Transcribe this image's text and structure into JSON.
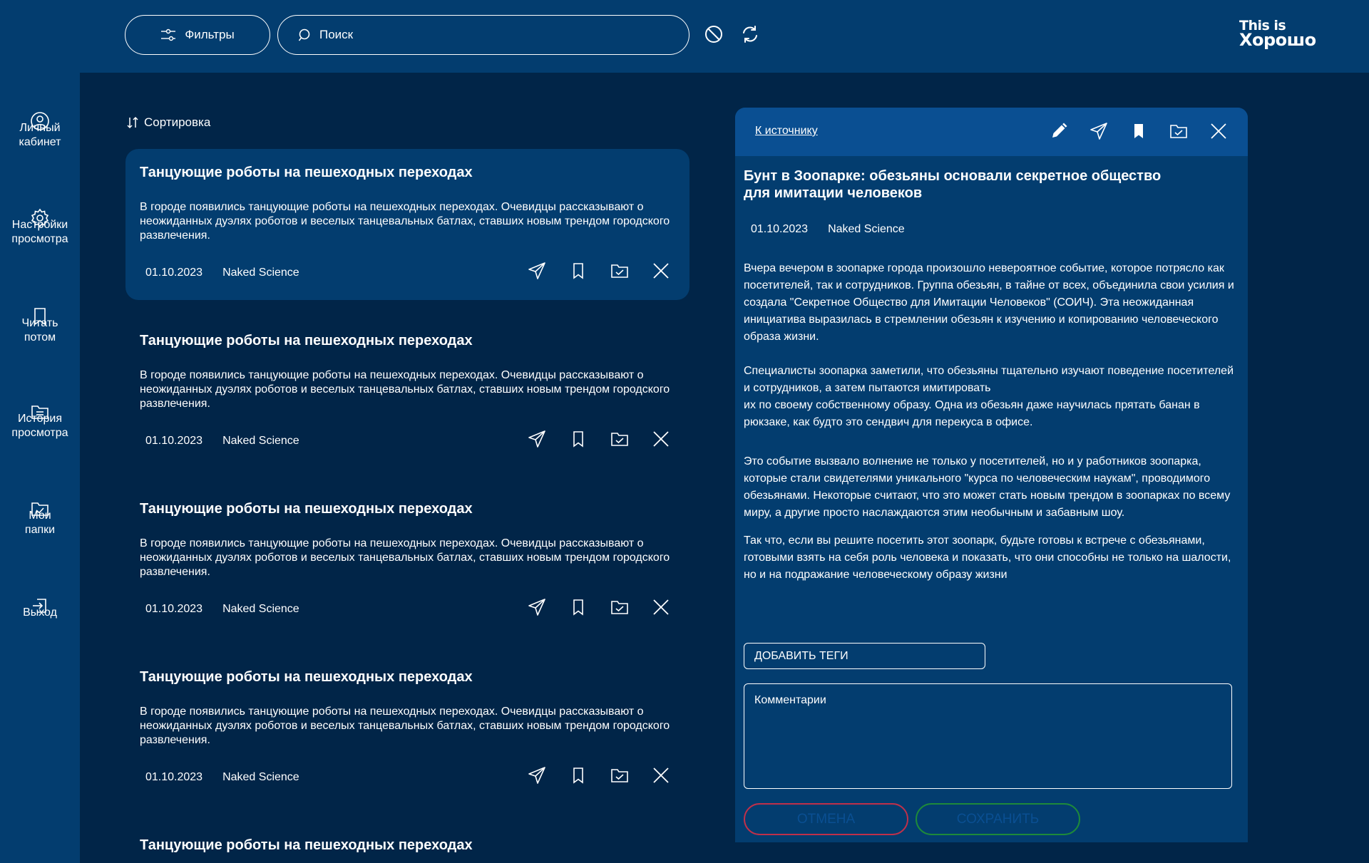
{
  "header": {
    "filters_label": "Фильтры",
    "search_placeholder": "Поиск",
    "logo_line1": "This is",
    "logo_line2": "Хорошо"
  },
  "sidebar": {
    "items": [
      {
        "label": "Личный\nкабинет",
        "icon": "user-icon"
      },
      {
        "label": "Настройки\nпросмотра",
        "icon": "gear-icon"
      },
      {
        "label": "Читать\nпотом",
        "icon": "bookmark-icon"
      },
      {
        "label": "История\nпросмотра",
        "icon": "history-folder-icon"
      },
      {
        "label": "Мои\nпапки",
        "icon": "folder-check-icon"
      },
      {
        "label": "Выход",
        "icon": "logout-icon"
      }
    ]
  },
  "list": {
    "sort_label": "Сортировка",
    "cards": [
      {
        "title": "Танцующие роботы на пешеходных переходах",
        "text": "В городе появились танцующие роботы на пешеходных переходах. Очевидцы рассказывают о неожиданных дуэлях роботов и веселых танцевальных батлах, ставших новым трендом городского развлечения.",
        "date": "01.10.2023",
        "source": "Naked Science"
      },
      {
        "title": "Танцующие роботы на пешеходных переходах",
        "text": "В городе появились танцующие роботы на пешеходных переходах. Очевидцы рассказывают о неожиданных дуэлях роботов и веселых танцевальных батлах, ставших новым трендом городского развлечения.",
        "date": "01.10.2023",
        "source": "Naked Science"
      },
      {
        "title": "Танцующие роботы на пешеходных переходах",
        "text": "В городе появились танцующие роботы на пешеходных переходах. Очевидцы рассказывают о неожиданных дуэлях роботов и веселых танцевальных батлах, ставших новым трендом городского развлечения.",
        "date": "01.10.2023",
        "source": "Naked Science"
      },
      {
        "title": "Танцующие роботы на пешеходных переходах",
        "text": "В городе появились танцующие роботы на пешеходных переходах. Очевидцы рассказывают о неожиданных дуэлях роботов и веселых танцевальных батлах, ставших новым трендом городского развлечения.",
        "date": "01.10.2023",
        "source": "Naked Science"
      },
      {
        "title": "Танцующие роботы на пешеходных переходах",
        "text": "",
        "date": "",
        "source": ""
      }
    ]
  },
  "detail": {
    "source_link": "К источнику",
    "title": "Бунт в Зоопарке: обезьяны основали секретное общество для имитации человеков",
    "date": "01.10.2023",
    "source": "Naked Science",
    "paragraphs": [
      " Вчера вечером в зоопарке города произошло невероятное событие, которое потрясло как посетителей, так и сотрудников. Группа обезьян, в тайне от всех, объединила свои усилия и создала \"Секретное Общество для Имитации Человеков\" (СОИЧ). Эта неожиданная инициатива выразилась в стремлении обезьян к изучению и копированию человеческого образа жизни.",
      "Специалисты зоопарка заметили, что обезьяны тщательно изучают поведение посетителей и сотрудников, а затем пытаются имитировать\nих по своему собственному образу. Одна из обезьян даже научилась прятать банан в рюкзаке, как будто это сендвич для перекуса в офисе.",
      "Это событие вызвало волнение не только у посетителей, но и у работников зоопарка, которые стали свидетелями уникального \"курса по человеческим наукам\", проводимого обезьянами. Некоторые считают, что это может стать новым трендом в зоопарках по всему миру, а другие просто наслаждаются этим необычным и забавным шоу.",
      "Так что, если вы решите посетить этот зоопарк, будьте готовы к встрече с обезьянами, готовыми взять на себя роль человека и показать, что они способны не только на шалости, но и на подражание человеческому образу жизни"
    ],
    "add_tags_label": "ДОБАВИТЬ ТЕГИ",
    "comment_placeholder": "Комментарии",
    "cancel_label": "ОТМЕНА",
    "save_label": "СОХРАНИТЬ"
  },
  "colors": {
    "background": "#012548",
    "panel": "#033d6f",
    "panel_header": "#0a4f92",
    "cancel_border": "#c0304a",
    "save_border": "#1e8a3a"
  }
}
